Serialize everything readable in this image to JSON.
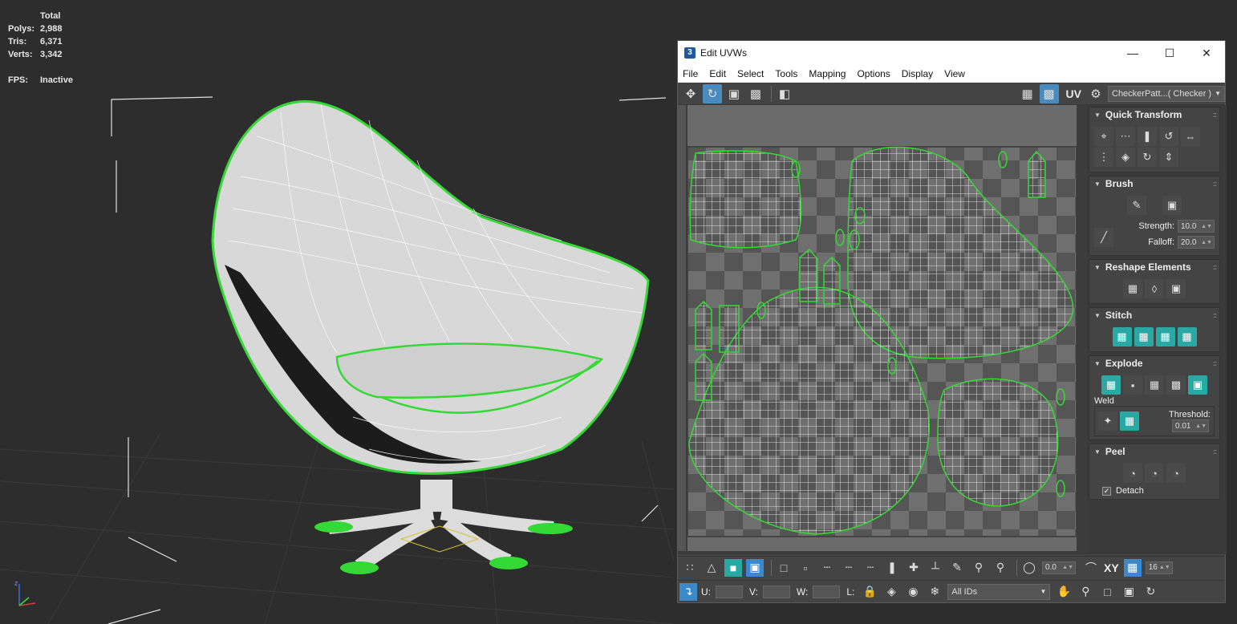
{
  "viewport": {
    "stats": {
      "header": "Total",
      "polys_label": "Polys:",
      "polys_value": "2,988",
      "tris_label": "Tris:",
      "tris_value": "6,371",
      "verts_label": "Verts:",
      "verts_value": "3,342",
      "fps_label": "FPS:",
      "fps_value": "Inactive"
    },
    "axis": {
      "z": "z"
    }
  },
  "uvw_window": {
    "app_icon": "3",
    "title": "Edit UVWs",
    "menu": [
      "File",
      "Edit",
      "Select",
      "Tools",
      "Mapping",
      "Options",
      "Display",
      "View"
    ],
    "uv_label": "UV",
    "checker_select": "CheckerPatt...( Checker )",
    "panels": {
      "quick_transform": "Quick Transform",
      "brush": "Brush",
      "strength_label": "Strength:",
      "strength_value": "10.0",
      "falloff_label": "Falloff:",
      "falloff_value": "20.0",
      "reshape": "Reshape Elements",
      "stitch": "Stitch",
      "explode": "Explode",
      "weld_label": "Weld",
      "threshold_label": "Threshold:",
      "threshold_value": "0.01",
      "peel": "Peel",
      "detach_label": "Detach"
    },
    "bottom": {
      "rotate_value": "0.0",
      "xy_label": "XY",
      "grid_value": "16",
      "u_label": "U:",
      "v_label": "V:",
      "w_label": "W:",
      "l_label": "L:",
      "ids_select": "All IDs"
    }
  }
}
